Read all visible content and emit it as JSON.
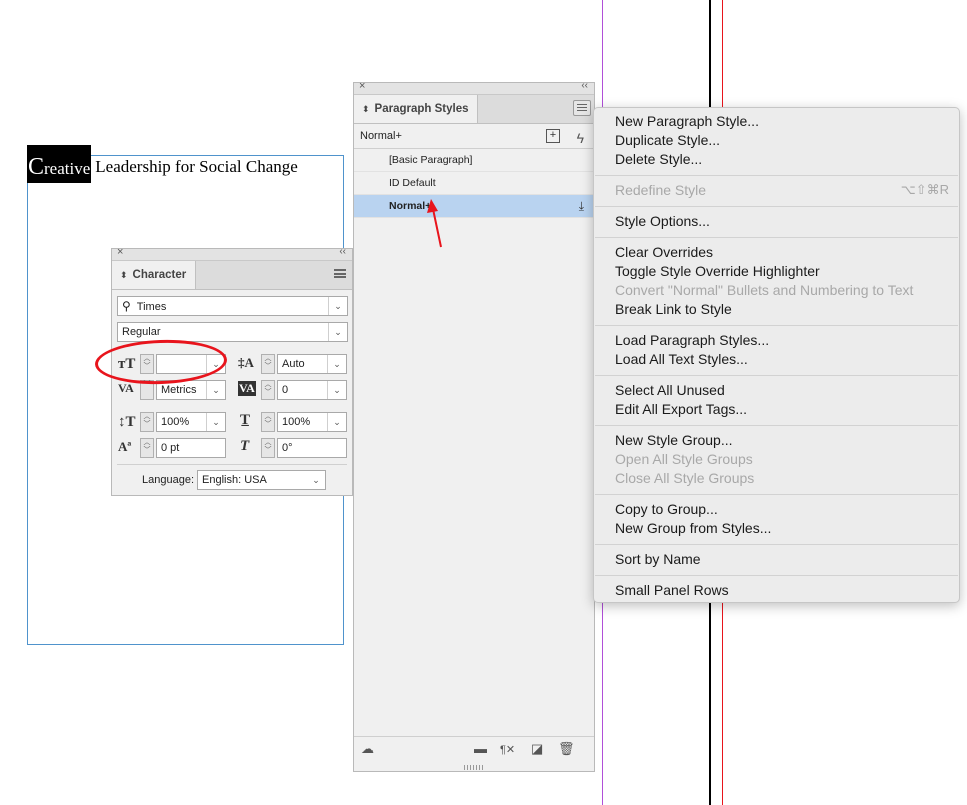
{
  "document": {
    "selected_cap": "C",
    "selected_rest": "reative",
    "line_rest": "Leadership for Social Change"
  },
  "paragraph_styles": {
    "tab_label": "Paragraph Styles",
    "current_style": "Normal+",
    "styles": [
      "[Basic Paragraph]",
      "ID Default",
      "Normal+"
    ],
    "selected_index": 2
  },
  "character": {
    "tab_label": "Character",
    "font_family": "Times",
    "font_style": "Regular",
    "font_size": "",
    "leading": "Auto",
    "kerning": "Metrics",
    "tracking": "0",
    "vertical_scale": "100%",
    "horizontal_scale": "100%",
    "baseline_shift": "0 pt",
    "skew": "0°",
    "language_label": "Language:",
    "language_value": "English: USA"
  },
  "context_menu": {
    "items": [
      {
        "label": "New Paragraph Style...",
        "enabled": true
      },
      {
        "label": "Duplicate Style...",
        "enabled": true
      },
      {
        "label": "Delete Style...",
        "enabled": true
      },
      {
        "label": "Redefine Style",
        "enabled": false,
        "shortcut": "⌥⇧⌘R"
      },
      {
        "label": "Style Options...",
        "enabled": true
      },
      {
        "label": "Clear Overrides",
        "enabled": true
      },
      {
        "label": "Toggle Style Override Highlighter",
        "enabled": true
      },
      {
        "label": "Convert \"Normal\" Bullets and Numbering to Text",
        "enabled": false
      },
      {
        "label": "Break Link to Style",
        "enabled": true
      },
      {
        "label": "Load Paragraph Styles...",
        "enabled": true
      },
      {
        "label": "Load All Text Styles...",
        "enabled": true
      },
      {
        "label": "Select All Unused",
        "enabled": true
      },
      {
        "label": "Edit All Export Tags...",
        "enabled": true
      },
      {
        "label": "New Style Group...",
        "enabled": true
      },
      {
        "label": "Open All Style Groups",
        "enabled": false
      },
      {
        "label": "Close All Style Groups",
        "enabled": false
      },
      {
        "label": "Copy to Group...",
        "enabled": true
      },
      {
        "label": "New Group from Styles...",
        "enabled": true
      },
      {
        "label": "Sort by Name",
        "enabled": true
      },
      {
        "label": "Small Panel Rows",
        "enabled": true
      }
    ]
  },
  "colors": {
    "selection": "#b9d3f0",
    "annotation_red": "#e8141c",
    "frame_blue": "#4f93cc",
    "guide_purple": "#b04fd8",
    "guide_red": "#e8141c"
  },
  "icons": [
    "close-icon",
    "collapse-icon",
    "panel-menu-icon",
    "new-style-icon",
    "lightning-icon",
    "download-icon",
    "cloud-icon",
    "folder-icon",
    "clear-override-icon",
    "new-page-icon",
    "trash-icon",
    "search-icon",
    "font-size-icon",
    "leading-icon",
    "kerning-icon",
    "tracking-icon",
    "vertical-scale-icon",
    "horizontal-scale-icon",
    "baseline-shift-icon",
    "skew-icon"
  ]
}
